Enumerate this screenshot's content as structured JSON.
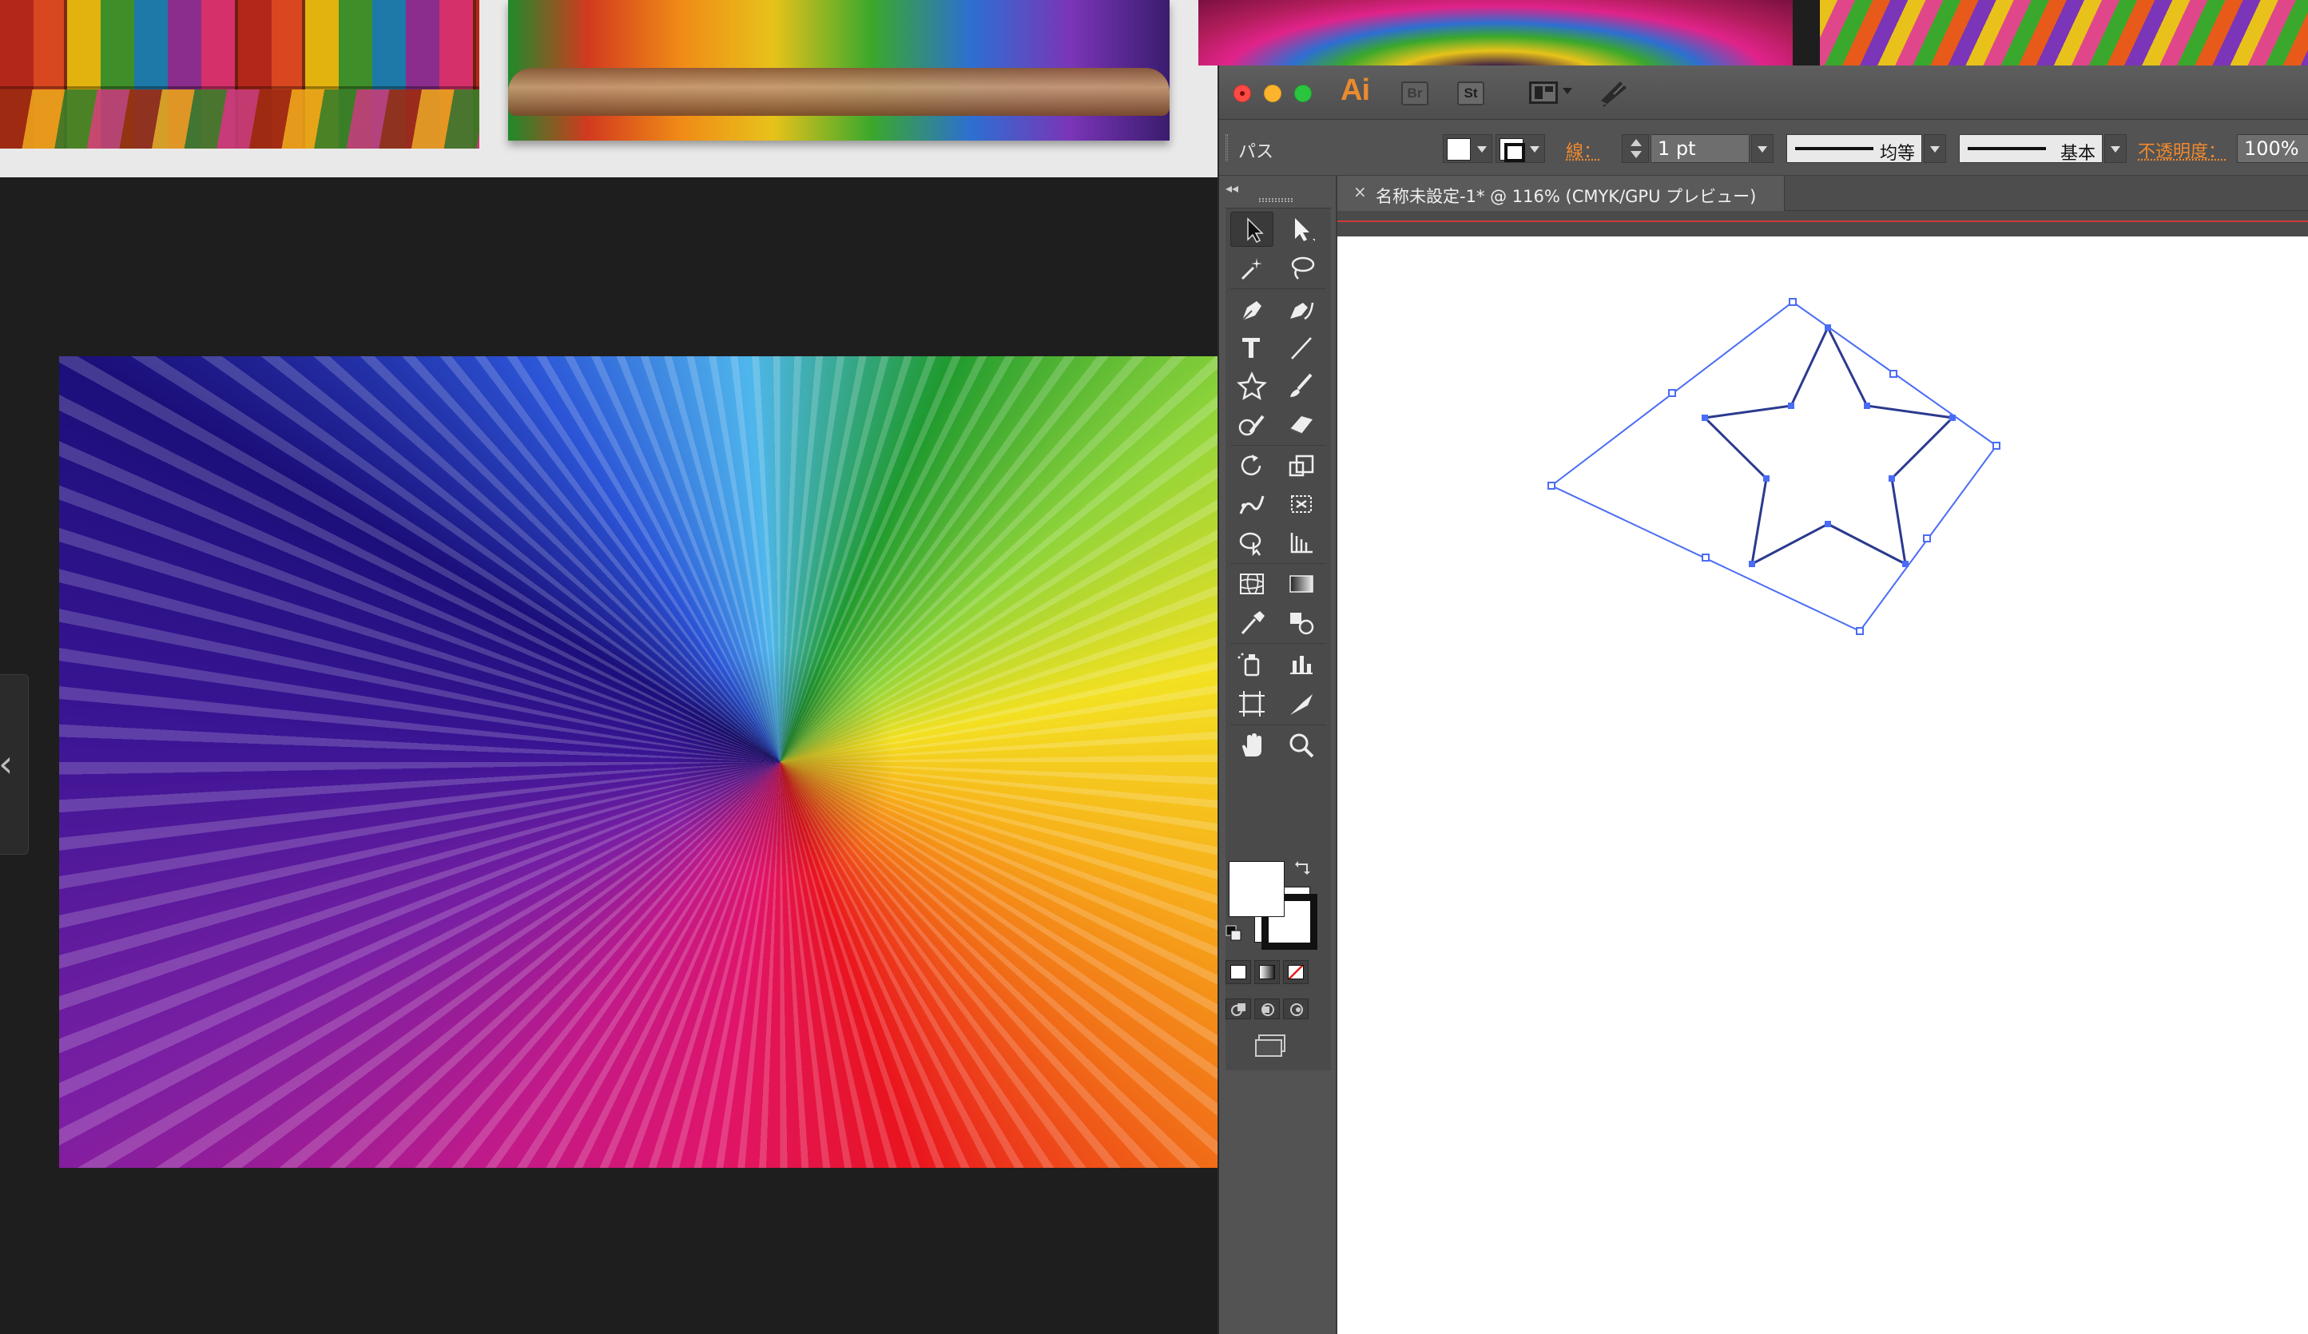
{
  "background_viewer": {
    "thumbnails": [
      "colorful-wood-planks",
      "parrots-on-branch",
      "rainbow-swirl",
      "rainbow-strands"
    ],
    "main_image": "rainbow-swirl"
  },
  "illustrator": {
    "app_logo": "Ai",
    "badges": {
      "bridge": "Br",
      "stock": "St"
    },
    "control_bar": {
      "selection_type": "パス",
      "stroke_label": "線：",
      "stroke_weight": "1 pt",
      "variable_width_profile": "均等",
      "brush_definition": "基本",
      "opacity_label": "不透明度：",
      "opacity_value": "100%"
    },
    "document_tab": {
      "close_glyph": "×",
      "title": "名称未設定-1* @ 116% (CMYK/GPU プレビュー)"
    },
    "tools": [
      "selection-tool",
      "direct-selection-tool",
      "magic-wand-tool",
      "lasso-tool",
      "pen-tool",
      "curvature-tool",
      "type-tool",
      "line-segment-tool",
      "star-tool",
      "paintbrush-tool",
      "shaper-tool",
      "eraser-tool",
      "rotate-tool",
      "scale-tool",
      "puppet-warp-tool",
      "free-transform-tool",
      "shape-builder-tool",
      "perspective-grid-tool",
      "mesh-tool",
      "gradient-tool",
      "eyedropper-tool",
      "blend-tool",
      "symbol-sprayer-tool",
      "column-graph-tool",
      "artboard-tool",
      "slice-tool",
      "hand-tool",
      "zoom-tool"
    ],
    "colors": {
      "fill": "#ffffff",
      "stroke": "#000000",
      "selection": "#4a6cf5",
      "path": "#2b3a8f",
      "accent_orange": "#f08a2e"
    },
    "active_tool": "selection-tool"
  }
}
